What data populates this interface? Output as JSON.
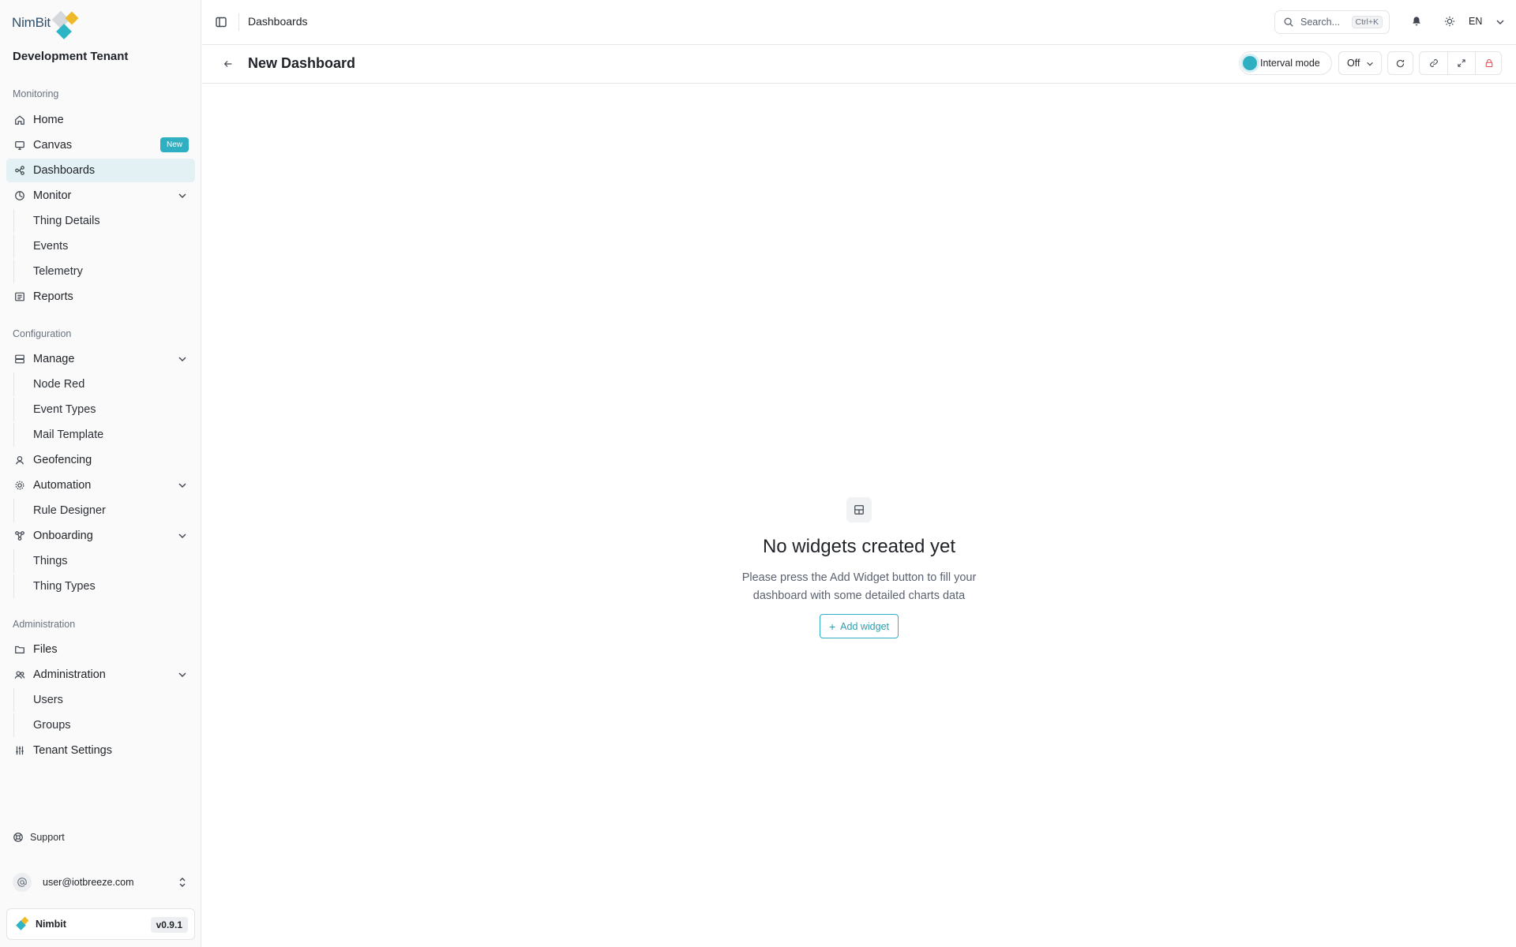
{
  "brand": {
    "name": "NimBit",
    "tenant": "Development Tenant"
  },
  "sidebar": {
    "sections": {
      "monitoring": "Monitoring",
      "configuration": "Configuration",
      "administration": "Administration"
    },
    "items": {
      "home": "Home",
      "canvas": "Canvas",
      "canvas_badge": "New",
      "dashboards": "Dashboards",
      "monitor": "Monitor",
      "thing_details": "Thing Details",
      "events": "Events",
      "telemetry": "Telemetry",
      "reports": "Reports",
      "manage": "Manage",
      "node_red": "Node Red",
      "event_types": "Event Types",
      "mail_template": "Mail Template",
      "geofencing": "Geofencing",
      "automation": "Automation",
      "rule_designer": "Rule Designer",
      "onboarding": "Onboarding",
      "things": "Things",
      "thing_types": "Thing Types",
      "files": "Files",
      "administration": "Administration",
      "users": "Users",
      "groups": "Groups",
      "tenant_settings": "Tenant Settings"
    },
    "support": "Support",
    "user_email": "user@iotbreeze.com",
    "app_name": "Nimbit",
    "version": "v0.9.1"
  },
  "topbar": {
    "breadcrumb": "Dashboards",
    "search_placeholder": "Search...",
    "search_shortcut": "Ctrl+K",
    "language": "EN"
  },
  "dashboard": {
    "title": "New Dashboard",
    "interval_mode": "Interval mode",
    "refresh_value": "Off"
  },
  "empty_state": {
    "title": "No widgets created yet",
    "description": "Please press the Add Widget button to fill your dashboard with some detailed charts data",
    "button": "Add widget"
  },
  "colors": {
    "accent": "#2fb0c2",
    "active_bg": "#e3f1f4",
    "danger": "#e5484d"
  }
}
